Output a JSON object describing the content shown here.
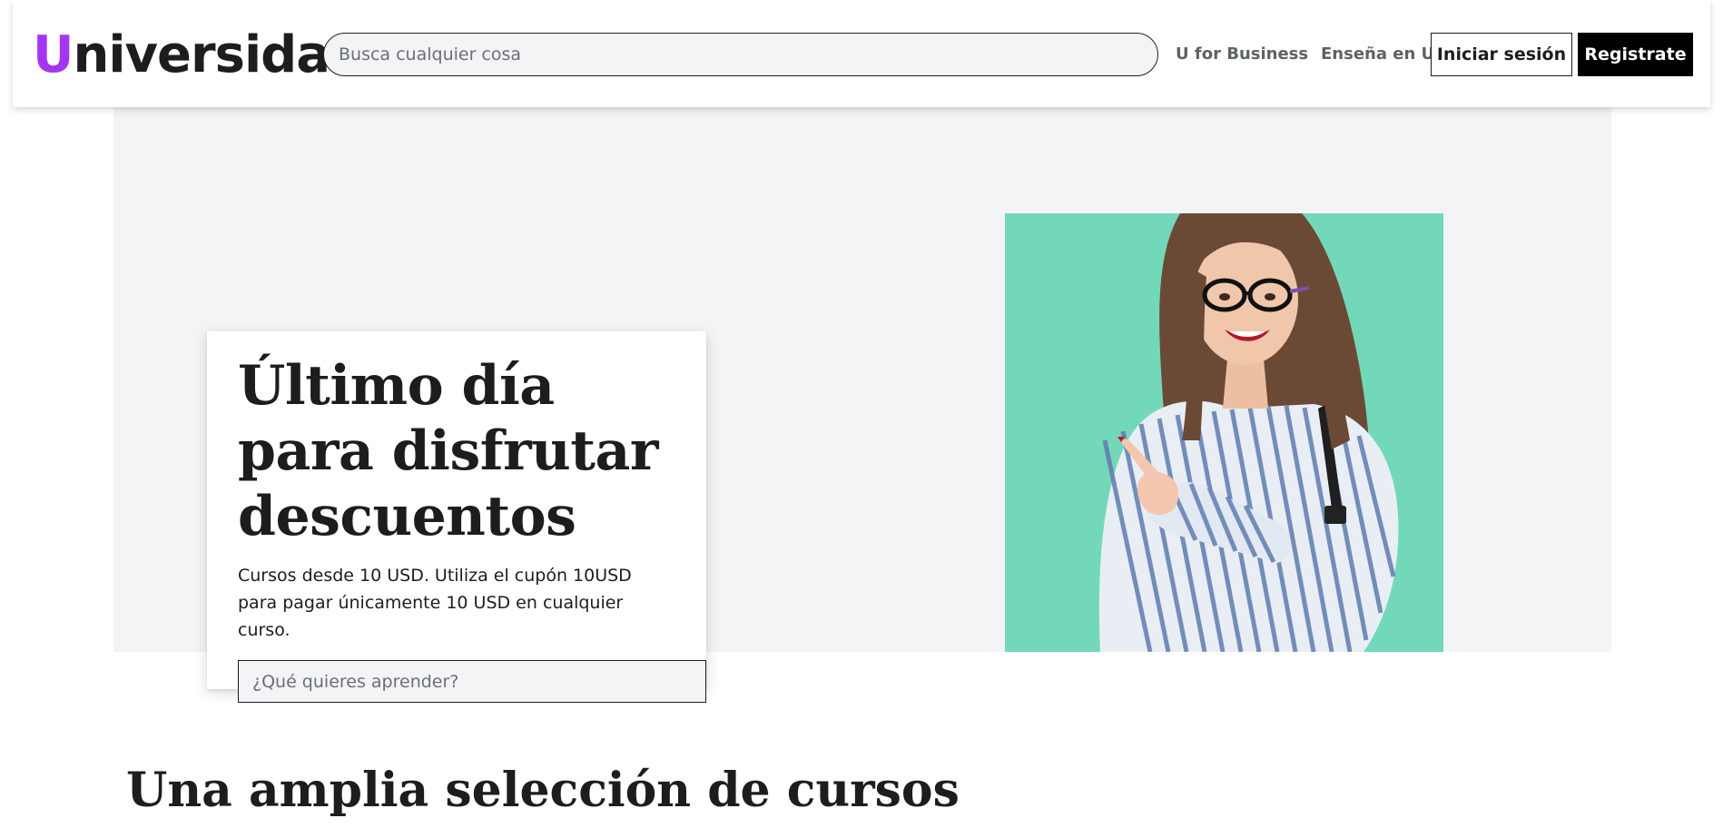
{
  "header": {
    "logo_initial": "U",
    "logo_rest": "niversidad",
    "search_placeholder": "Busca cualquier cosa",
    "nav_business": "U for Business",
    "nav_teach": "Enseña en U",
    "login_label": "Iniciar sesión",
    "signup_label": "Registrate"
  },
  "hero": {
    "title": "Último día para disfrutar descuentos",
    "text": "Cursos desde 10 USD. Utiliza el cupón 10USD para pagar únicamente 10 USD en cualquier curso.",
    "search_placeholder": "¿Qué quieres aprender?"
  },
  "section": {
    "title": "Una amplia selección de cursos"
  },
  "colors": {
    "brand_accent": "#a435f0",
    "hero_background": "#f3f4f6",
    "image_backdrop": "#73d8b9",
    "primary_button": "#000000"
  },
  "icons": {
    "hero_image": "woman-pointing-photo"
  }
}
